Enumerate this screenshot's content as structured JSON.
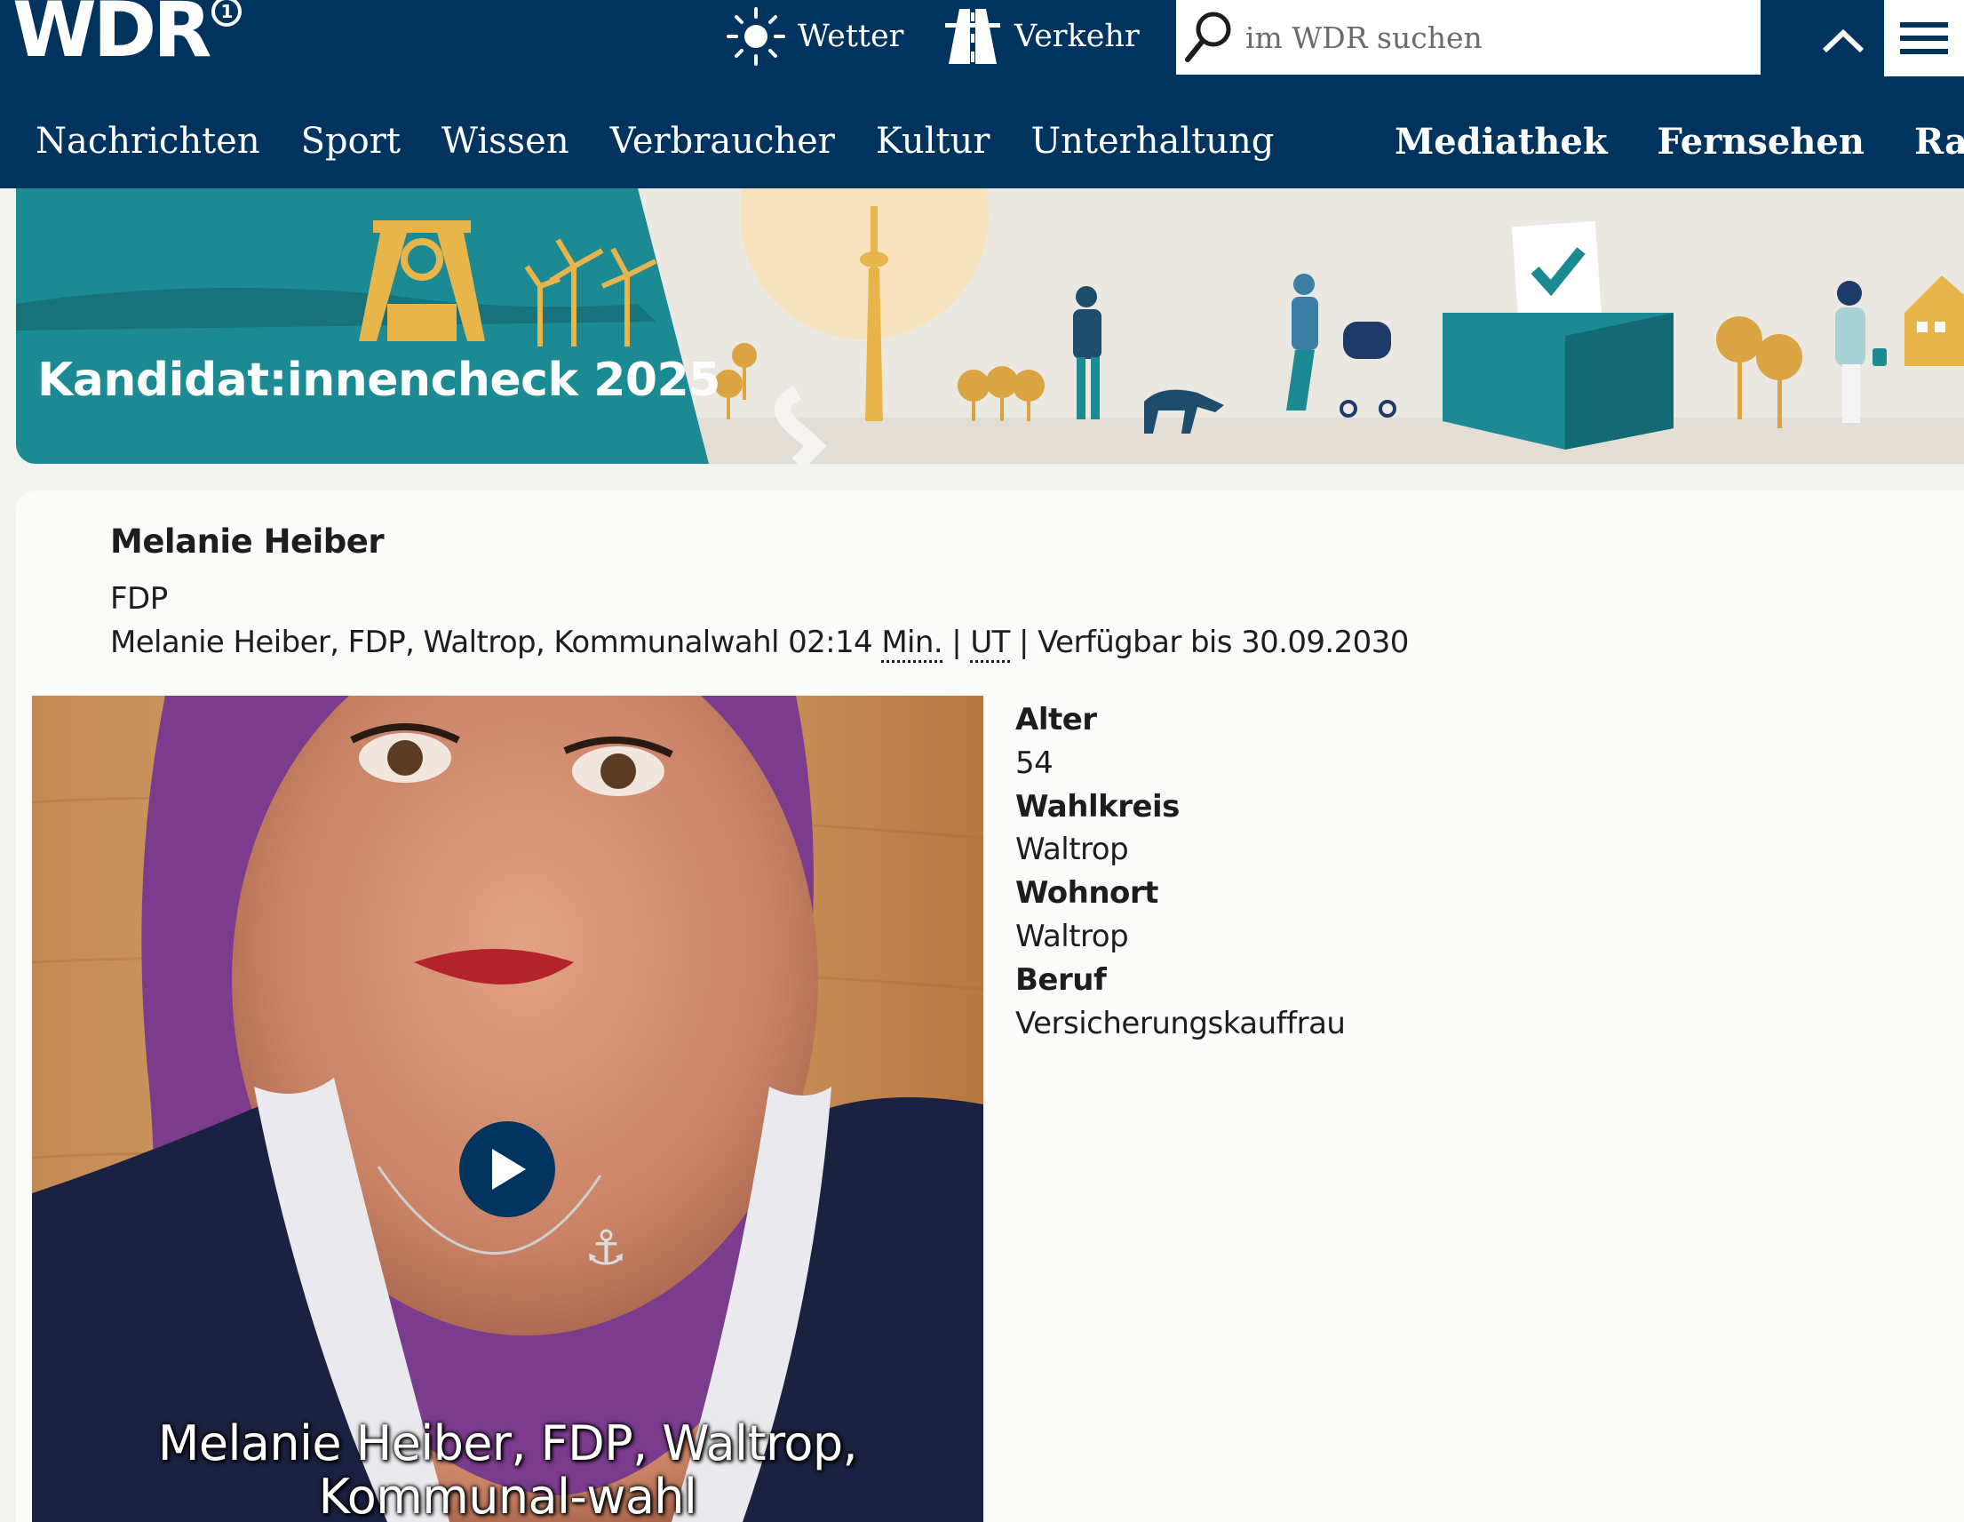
{
  "header": {
    "logo_text": "WDR",
    "logo_badge": "1",
    "util": {
      "wetter_label": "Wetter",
      "wetter_icon": "sun-icon",
      "verkehr_label": "Verkehr",
      "verkehr_icon": "road-icon"
    },
    "search": {
      "placeholder": "im WDR suchen",
      "icon": "search-icon"
    },
    "collapse_icon": "chevron-up-icon",
    "menu_icon": "hamburger-menu-icon",
    "nav_primary": [
      "Nachrichten",
      "Sport",
      "Wissen",
      "Verbraucher",
      "Kultur",
      "Unterhaltung"
    ],
    "nav_secondary": [
      "Mediathek",
      "Fernsehen",
      "Radio"
    ]
  },
  "banner": {
    "title": "Kandidat:innencheck 2025",
    "colors": {
      "teal": "#1b8a93",
      "sand": "#e9e5df",
      "gold": "#e7b54a"
    }
  },
  "candidate": {
    "name": "Melanie Heiber",
    "party": "FDP",
    "video_meta": {
      "title": "Melanie Heiber, FDP, Waltrop, Kommunalwahl",
      "duration": "02:14",
      "duration_unit": "Min.",
      "separator": "|",
      "subtitles": "UT",
      "availability": "Verfügbar bis 30.09.2030"
    },
    "video_caption": "Melanie Heiber, FDP, Waltrop, Kommunal-wahl",
    "play_icon": "play-icon",
    "facts": {
      "alter_label": "Alter",
      "alter_value": "54",
      "wahlkreis_label": "Wahlkreis",
      "wahlkreis_value": "Waltrop",
      "wohnort_label": "Wohnort",
      "wohnort_value": "Waltrop",
      "beruf_label": "Beruf",
      "beruf_value": "Versicherungskauffrau"
    }
  },
  "colors": {
    "header_bg": "#00345e",
    "page_bg": "#f2f2ee",
    "card_bg": "#fbfbf9",
    "text": "#1d1d1d"
  }
}
